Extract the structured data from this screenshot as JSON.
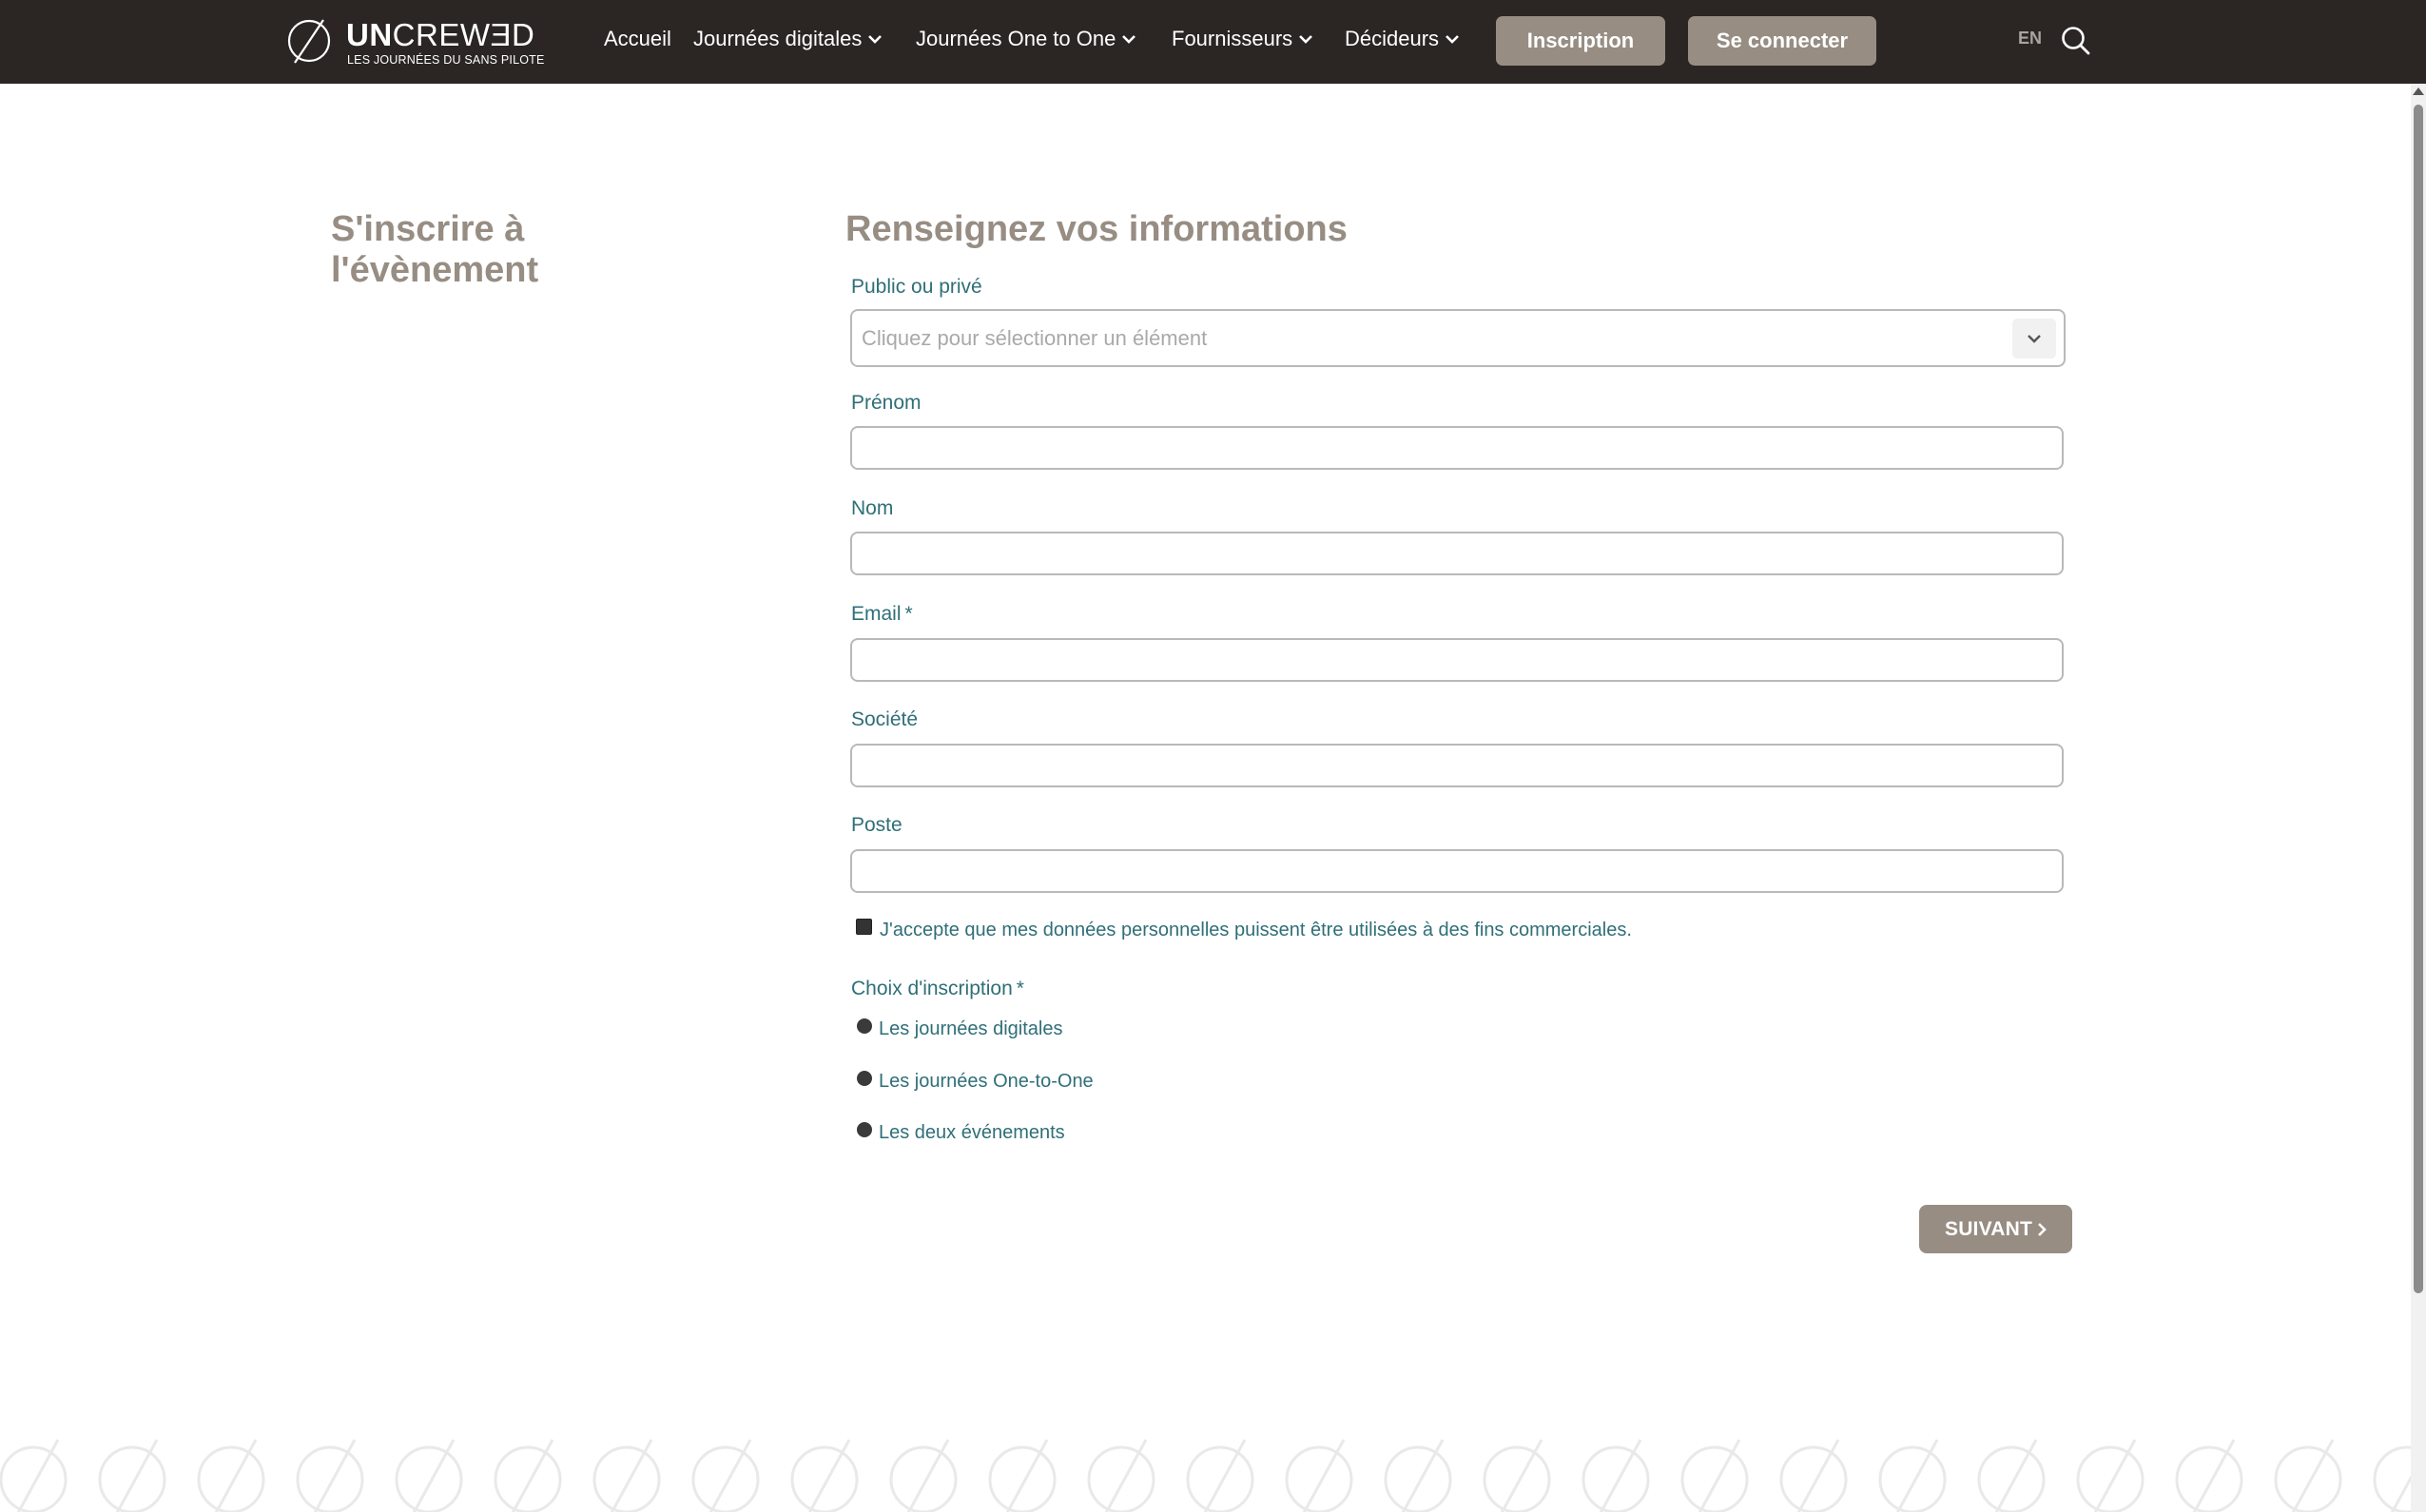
{
  "header": {
    "logo": {
      "brand_bold": "UN",
      "brand_light": "CREWƎD",
      "tagline": "LES JOURNÉES DU SANS PILOTE"
    },
    "nav": {
      "home": "Accueil",
      "digital_days": "Journées digitales",
      "one_to_one_days": "Journées One to One",
      "suppliers": "Fournisseurs",
      "decision_makers": "Décideurs"
    },
    "buttons": {
      "register": "Inscription",
      "login": "Se connecter"
    },
    "language": "EN"
  },
  "sidebar": {
    "title": "S'inscrire à l'évènement"
  },
  "form": {
    "title": "Renseignez vos informations",
    "public_private": {
      "label": "Public ou privé",
      "placeholder": "Cliquez pour sélectionner un élément"
    },
    "first_name": {
      "label": "Prénom",
      "value": ""
    },
    "last_name": {
      "label": "Nom",
      "value": ""
    },
    "email": {
      "label": "Email",
      "required_mark": "*",
      "value": ""
    },
    "company": {
      "label": "Société",
      "value": ""
    },
    "position": {
      "label": "Poste",
      "value": ""
    },
    "consent_label": "J'accepte que mes données personnelles puissent être utilisées à des fins commerciales.",
    "registration_choice": {
      "label": "Choix d'inscription",
      "required_mark": "*",
      "options": [
        "Les journées digitales",
        "Les journées One-to-One",
        "Les deux événements"
      ]
    },
    "next_button": "SUIVANT"
  },
  "colors": {
    "header_bg": "#2b2524",
    "accent_taupe": "#978d83",
    "label_teal": "#2f6f78",
    "input_border": "#b9b9b9"
  }
}
